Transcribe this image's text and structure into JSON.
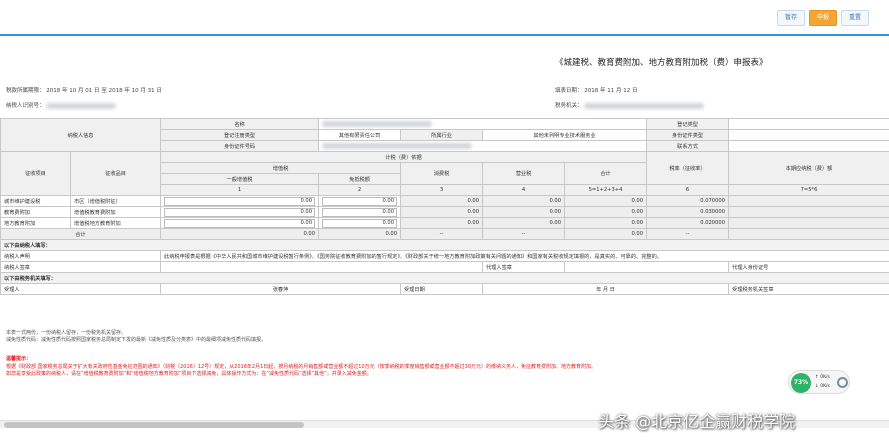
{
  "toolbar": {
    "btn_save": "暂存",
    "btn_submit": "申报",
    "btn_reset": "重置"
  },
  "form_title": "《城建税、教育费附加、地方教育附加税（费）申报表》",
  "period": {
    "label": "税款所属期限：",
    "from_year": "2018",
    "from_month": "10",
    "from_day": "01",
    "to_word": "至",
    "to_year": "2018",
    "to_month": "10",
    "to_day": "31",
    "year_unit": "年",
    "month_unit": "月",
    "day_unit": "日"
  },
  "fill_date": {
    "label": "填表日期：",
    "year": "2018",
    "month": "11",
    "day": "12",
    "year_unit": "年",
    "month_unit": "月",
    "day_unit": "日"
  },
  "taxpayer_id_label": "纳税人识别号：",
  "tax_amount_label": "税务机关：",
  "header": {
    "taxpayer_info": "纳税人信息",
    "name": "名称",
    "reg_type_label": "登记注册类型",
    "reg_type_value": "其他有限责任公司",
    "industry_label": "所属行业",
    "industry_value": "其他未列明专业技术服务业",
    "id_type": "身份证件号码",
    "reg_type_right": "登记类型",
    "id_type_right": "身份证件类型",
    "contact": "联系方式",
    "tax_basis": "计税（费）依据",
    "vat": "增值税",
    "general_vat": "一般增值税",
    "exempt_vat": "免抵税额",
    "consumption_tax": "消费税",
    "business_tax": "营业税",
    "total": "合计",
    "tax_item": "征收项目",
    "tax_subitem": "征收品目",
    "rate": "税率（征收率）",
    "current_tax": "本期应纳税（费）额",
    "col1": "1",
    "col2": "2",
    "col3": "3",
    "col4": "4",
    "col5": "5=1+2+3+4",
    "col6": "6",
    "col7": "7=5*6"
  },
  "rows": [
    {
      "item": "城市维护建设税",
      "subitem": "市区（增值税附征）",
      "v1": "0.00",
      "v2": "0.00",
      "v3": "0.00",
      "v4": "0.00",
      "v5": "0.00",
      "rate": "0.070000"
    },
    {
      "item": "教育费附加",
      "subitem": "增值税教育费附加",
      "v1": "0.00",
      "v2": "0.00",
      "v3": "0.00",
      "v4": "0.00",
      "v5": "0.00",
      "rate": "0.030000"
    },
    {
      "item": "地方教育附加",
      "subitem": "增值税地方教育附加",
      "v1": "0.00",
      "v2": "0.00",
      "v3": "0.00",
      "v4": "0.00",
      "v5": "0.00",
      "rate": "0.020000"
    }
  ],
  "total_row": {
    "label": "合计",
    "v1": "0.00",
    "v2": "0.00",
    "v3": "--",
    "v4": "--",
    "v5": "0.00",
    "rate": "--"
  },
  "taxpayer_section": {
    "title": "以下由纳税人填写：",
    "declaration_label": "纳税人声明",
    "declaration_text": "此纳税申报表是根据《中华人民共和国城市维护建设税暂行条例》、《国务院征收教育费附加的暂行规定》、《财政部关于统一地方教育附加政策有关问题的通知》和国家有关税收规定填报的，是真实的、可靠的、完整的。",
    "signature_label": "纳税人签章",
    "agent_label": "代理人签章",
    "agent_id_label": "代理人身份证号"
  },
  "tax_office_section": {
    "title": "以下由税务机关填写：",
    "receiver_label": "受理人",
    "receiver_value": "张春萍",
    "date_label": "受理日期",
    "date_value": "年    月    日",
    "office_seal_label": "受理税务机关签章"
  },
  "notes": {
    "line1": "本表一式两份，一份纳税人留存，一份税务机关留存。",
    "line2": "减免性质代码：减免性质代码按照国家税务总局制定下发的最新《减免性质及分类表》中的最细项减免性质代码填报。"
  },
  "warning": {
    "title": "温馨提示：",
    "line1": "根据《财政部 国家税务总局关于扩大有关政府性基金免征范围的通知》（财税〔2016〕12号）规定，从2016年2月1日起，按月纳税的月销售额或营业额不超过10万元（按季纳税的季度销售额或营业额不超过30万元）的缴纳义务人，免征教育费附加、地方教育附加。",
    "line2": "如您是享受此政策的纳税人，请在“增值税教育费附加”和“增值税地方教育附加”项目下选择减免，具体操作方式为：在“减免性质代码”选择“其他”，并录入减免金额。"
  },
  "net_widget": {
    "percent": "73%",
    "up": "0K/s",
    "down": "0K/s"
  },
  "watermark": "头条 @北京亿企赢财税学院",
  "colors": {
    "accent": "#3d8fd6",
    "primary_button": "#f4a632",
    "warning": "#d22222",
    "widget_green": "#2fb36a"
  }
}
